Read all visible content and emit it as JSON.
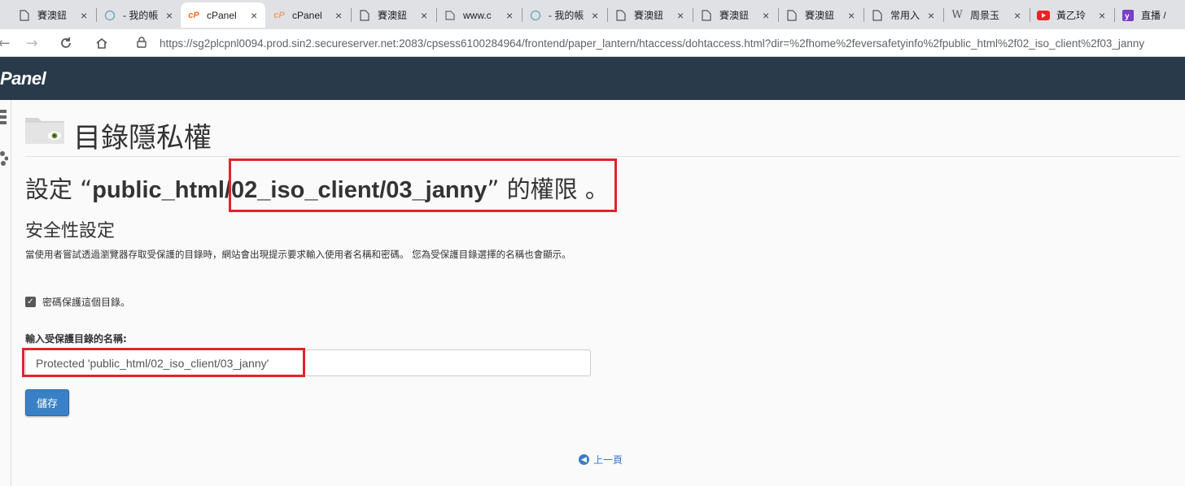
{
  "browser": {
    "tabs": [
      {
        "label": "賽澳鈕",
        "icon": "document-icon"
      },
      {
        "label": "- 我的帳",
        "icon": "globe-icon"
      },
      {
        "label": "cPanel",
        "icon": "cpanel-icon"
      },
      {
        "label": "cPanel",
        "icon": "cpanel-icon"
      },
      {
        "label": "賽澳鈕",
        "icon": "document-icon"
      },
      {
        "label": "www.c",
        "icon": "link-icon"
      },
      {
        "label": "- 我的帳",
        "icon": "globe-icon"
      },
      {
        "label": "賽澳鈕",
        "icon": "document-icon"
      },
      {
        "label": "賽澳鈕",
        "icon": "document-icon"
      },
      {
        "label": "賽澳鈕",
        "icon": "document-icon"
      },
      {
        "label": "常用入",
        "icon": "document-icon"
      },
      {
        "label": "周景玉",
        "icon": "wikipedia-icon"
      },
      {
        "label": "黃乙玲",
        "icon": "youtube-icon"
      },
      {
        "label": "直播 /",
        "icon": "yahoo-icon"
      }
    ],
    "url": "https://sg2plcpnl0094.prod.sin2.secureserver.net:2083/cpsess6100284964/frontend/paper_lantern/htaccess/dohtaccess.html?dir=%2fhome%2feversafetyinfo%2fpublic_html%2f02_iso_client%2f03_janny"
  },
  "header": {
    "logo": "Panel"
  },
  "page": {
    "title": "目錄隱私權",
    "heading_prefix": "設定 “",
    "heading_path": "public_html/02_iso_client/03_janny",
    "heading_suffix": "” 的權限 。",
    "security_title": "安全性設定",
    "description": "當使用者嘗試透過瀏覽器存取受保護的目錄時，網站會出現提示要求輸入使用者名稱和密碼。 您為受保護目錄選擇的名稱也會顯示。",
    "checkbox_label": "密碼保護這個目錄。",
    "checkbox_checked": true,
    "field_label": "輸入受保護目錄的名稱:",
    "field_value": "Protected 'public_html/02_iso_client/03_janny'",
    "save_label": "儲存",
    "back_label": "上一頁"
  },
  "colors": {
    "header_bg": "#293a4a",
    "button_bg": "#3980c6",
    "highlight": "#e0242b",
    "link": "#3b7cc2"
  }
}
